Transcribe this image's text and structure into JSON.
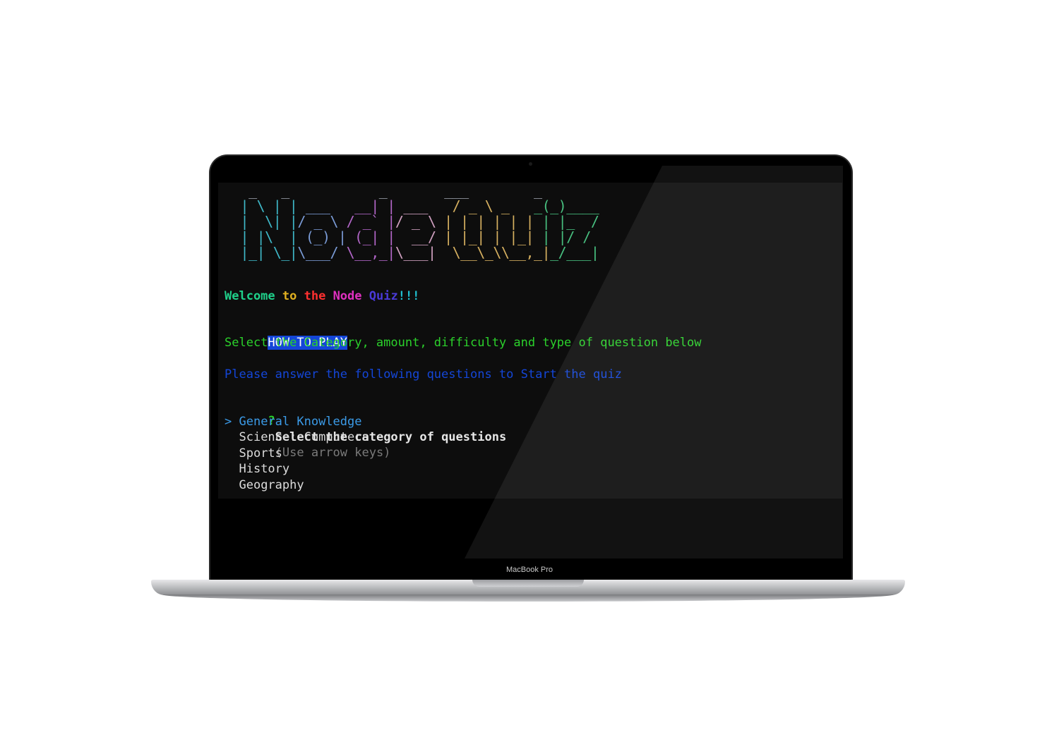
{
  "device": {
    "label": "MacBook Pro"
  },
  "ascii_logo": {
    "lines": [
      [
        {
          "t": "  _   _           _       ___        _      ",
          "c": "#9aa0aa"
        }
      ],
      [
        {
          "t": " | \\ | |",
          "c": "#3fb8c8"
        },
        {
          "t": " ___   ",
          "c": "#7a9bd6"
        },
        {
          "t": "__| |",
          "c": "#b266c8"
        },
        {
          "t": " ___   ",
          "c": "#d0a0c0"
        },
        {
          "t": "/ _ \\ _   ",
          "c": "#d6b060"
        },
        {
          "t": "_(_)____",
          "c": "#48c080"
        }
      ],
      [
        {
          "t": " |  \\| |",
          "c": "#3fb8c8"
        },
        {
          "t": "/ _ \\ ",
          "c": "#7a9bd6"
        },
        {
          "t": "/ _` |",
          "c": "#b266c8"
        },
        {
          "t": "/ _ \\ ",
          "c": "#d0a0c0"
        },
        {
          "t": "| | | | | | ",
          "c": "#d6b060"
        },
        {
          "t": "| |_  /",
          "c": "#48c080"
        }
      ],
      [
        {
          "t": " | |\\  |",
          "c": "#3fb8c8"
        },
        {
          "t": " (_) |",
          "c": "#7a9bd6"
        },
        {
          "t": " (_| |",
          "c": "#b266c8"
        },
        {
          "t": "  __/ ",
          "c": "#d0a0c0"
        },
        {
          "t": "| |_| | |_| ",
          "c": "#d6b060"
        },
        {
          "t": "| |/ / ",
          "c": "#48c080"
        }
      ],
      [
        {
          "t": " |_| \\_|",
          "c": "#3fb8c8"
        },
        {
          "t": "\\___/ ",
          "c": "#7a9bd6"
        },
        {
          "t": "\\__,_|",
          "c": "#b266c8"
        },
        {
          "t": "\\___| ",
          "c": "#d0a0c0"
        },
        {
          "t": " \\__\\_\\\\__,_|",
          "c": "#d6b060"
        },
        {
          "t": "_/___|",
          "c": "#48c080"
        }
      ]
    ]
  },
  "welcome": [
    {
      "t": "Welcome ",
      "c": "#1fd08a"
    },
    {
      "t": "to ",
      "c": "#e0b020"
    },
    {
      "t": "the ",
      "c": "#ff3030"
    },
    {
      "t": "Node ",
      "c": "#e030c0"
    },
    {
      "t": "Quiz",
      "c": "#4a3ad8"
    },
    {
      "t": "!!!",
      "c": "#20c0d0"
    }
  ],
  "howto": {
    "label": "HOW TO PLAY",
    "text": "Select the Category, amount, difficulty and type of question below",
    "text_color": "#2bd12b",
    "label_bg": "#1446d8"
  },
  "answer_prompt": {
    "text": "Please answer the following questions to Start the quiz",
    "color": "#1446d8"
  },
  "question": {
    "mark": "?",
    "mark_color": "#2bd12b",
    "text": "Select the category of questions",
    "hint": "(Use arrow keys)",
    "hint_color": "#7a7a7a"
  },
  "choices": {
    "pointer": ">",
    "selected_color": "#3b9be8",
    "items": [
      {
        "label": "General Knowledge",
        "selected": true
      },
      {
        "label": "Science: Computers",
        "selected": false
      },
      {
        "label": "Sports",
        "selected": false
      },
      {
        "label": "History",
        "selected": false
      },
      {
        "label": "Geography",
        "selected": false
      }
    ]
  }
}
